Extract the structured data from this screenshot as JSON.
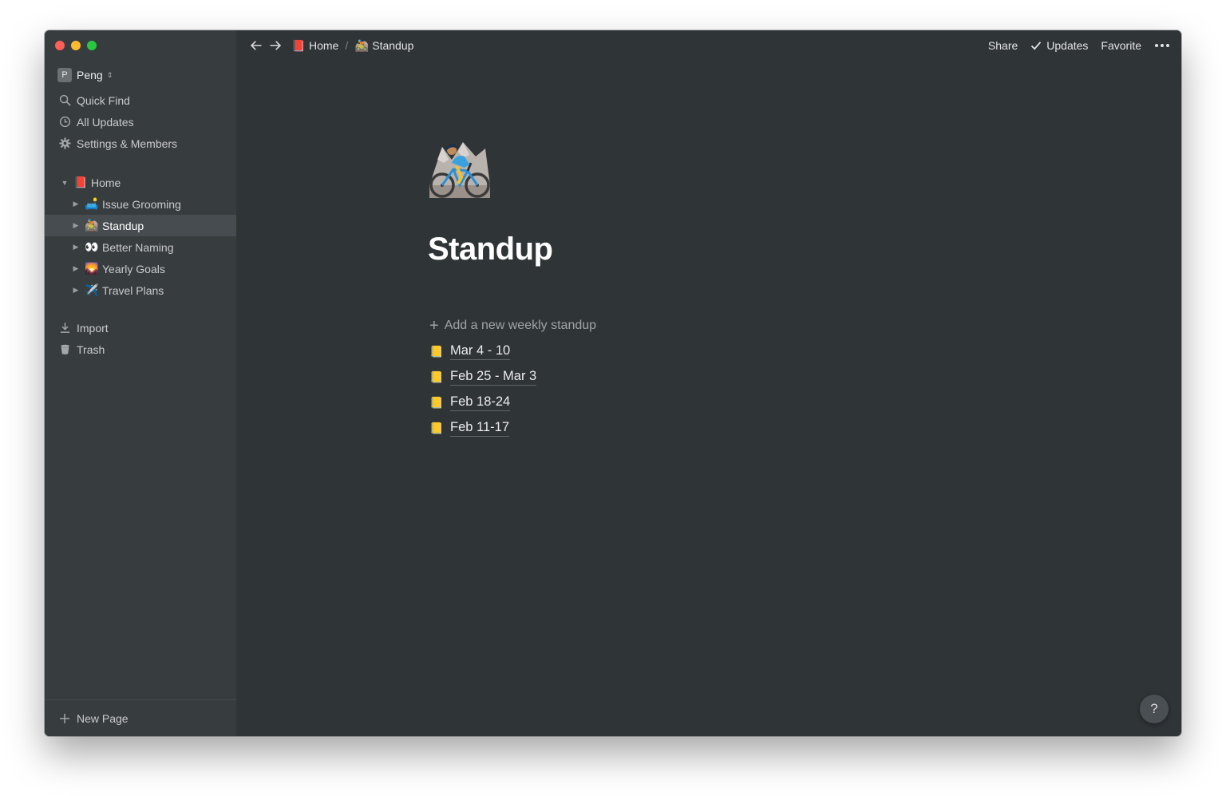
{
  "window": {
    "traffic_lights": [
      "close",
      "minimize",
      "zoom"
    ]
  },
  "sidebar": {
    "workspace": {
      "badge": "P",
      "name": "Peng"
    },
    "top_items": [
      {
        "icon": "search-icon",
        "label": "Quick Find"
      },
      {
        "icon": "clock-icon",
        "label": "All Updates"
      },
      {
        "icon": "gear-icon",
        "label": "Settings & Members"
      }
    ],
    "tree": {
      "root": {
        "emoji": "📕",
        "label": "Home"
      },
      "children": [
        {
          "emoji": "🛋️",
          "label": "Issue Grooming"
        },
        {
          "emoji": "🚵",
          "label": "Standup",
          "selected": true
        },
        {
          "emoji": "👀",
          "label": "Better Naming"
        },
        {
          "emoji": "🌄",
          "label": "Yearly Goals"
        },
        {
          "emoji": "✈️",
          "label": "Travel Plans"
        }
      ]
    },
    "bottom_items": [
      {
        "icon": "download-icon",
        "label": "Import"
      },
      {
        "icon": "trash-icon",
        "label": "Trash"
      }
    ],
    "new_page_label": "New Page"
  },
  "topbar": {
    "breadcrumb": [
      {
        "emoji": "📕",
        "label": "Home"
      },
      {
        "emoji": "🚵",
        "label": "Standup"
      }
    ],
    "separator": "/",
    "share_label": "Share",
    "updates_label": "Updates",
    "favorite_label": "Favorite"
  },
  "page": {
    "icon": "mountain-biker-icon",
    "title": "Standup",
    "add_label": "Add a new weekly standup",
    "entries": [
      {
        "emoji": "📒",
        "label": "Mar 4 - 10"
      },
      {
        "emoji": "📒",
        "label": "Feb 25 - Mar 3"
      },
      {
        "emoji": "📒",
        "label": "Feb 18-24"
      },
      {
        "emoji": "📒",
        "label": "Feb 11-17"
      }
    ]
  },
  "help_label": "?",
  "colors": {
    "main_bg": "#2f3437",
    "sidebar_bg": "#373c3f",
    "selected_bg": "#474c50",
    "text": "#ececec"
  }
}
